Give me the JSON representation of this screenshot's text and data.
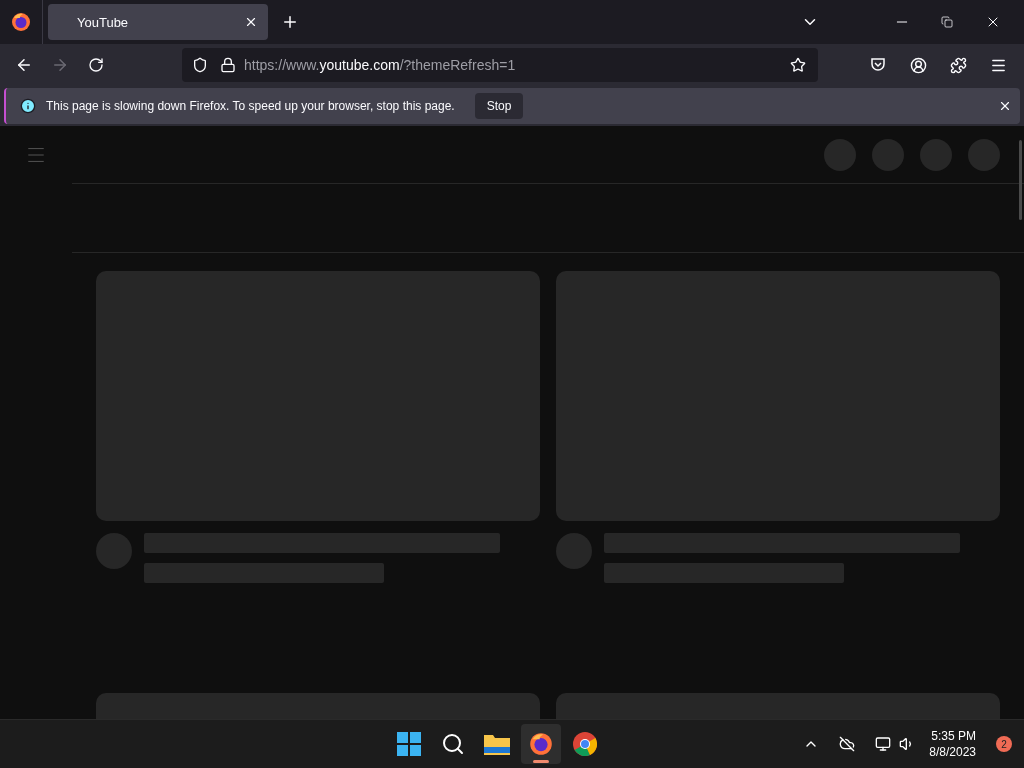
{
  "tabs": [
    {
      "title": "YouTube",
      "selected": true
    }
  ],
  "address_bar": {
    "url": {
      "prefix": "https://www.",
      "host": "youtube.com",
      "suffix": "/?themeRefresh=1"
    }
  },
  "notification": {
    "message": "This page is slowing down Firefox. To speed up your browser, stop this page.",
    "button": "Stop"
  },
  "taskbar": {
    "apps": [
      {
        "kind": "start",
        "active": false
      },
      {
        "kind": "search",
        "active": false
      },
      {
        "kind": "files",
        "active": false
      },
      {
        "kind": "firefox",
        "active": true
      },
      {
        "kind": "chrome",
        "active": false
      }
    ],
    "clock": {
      "time": "5:35 PM",
      "date": "8/8/2023"
    },
    "notification_count": "2"
  }
}
